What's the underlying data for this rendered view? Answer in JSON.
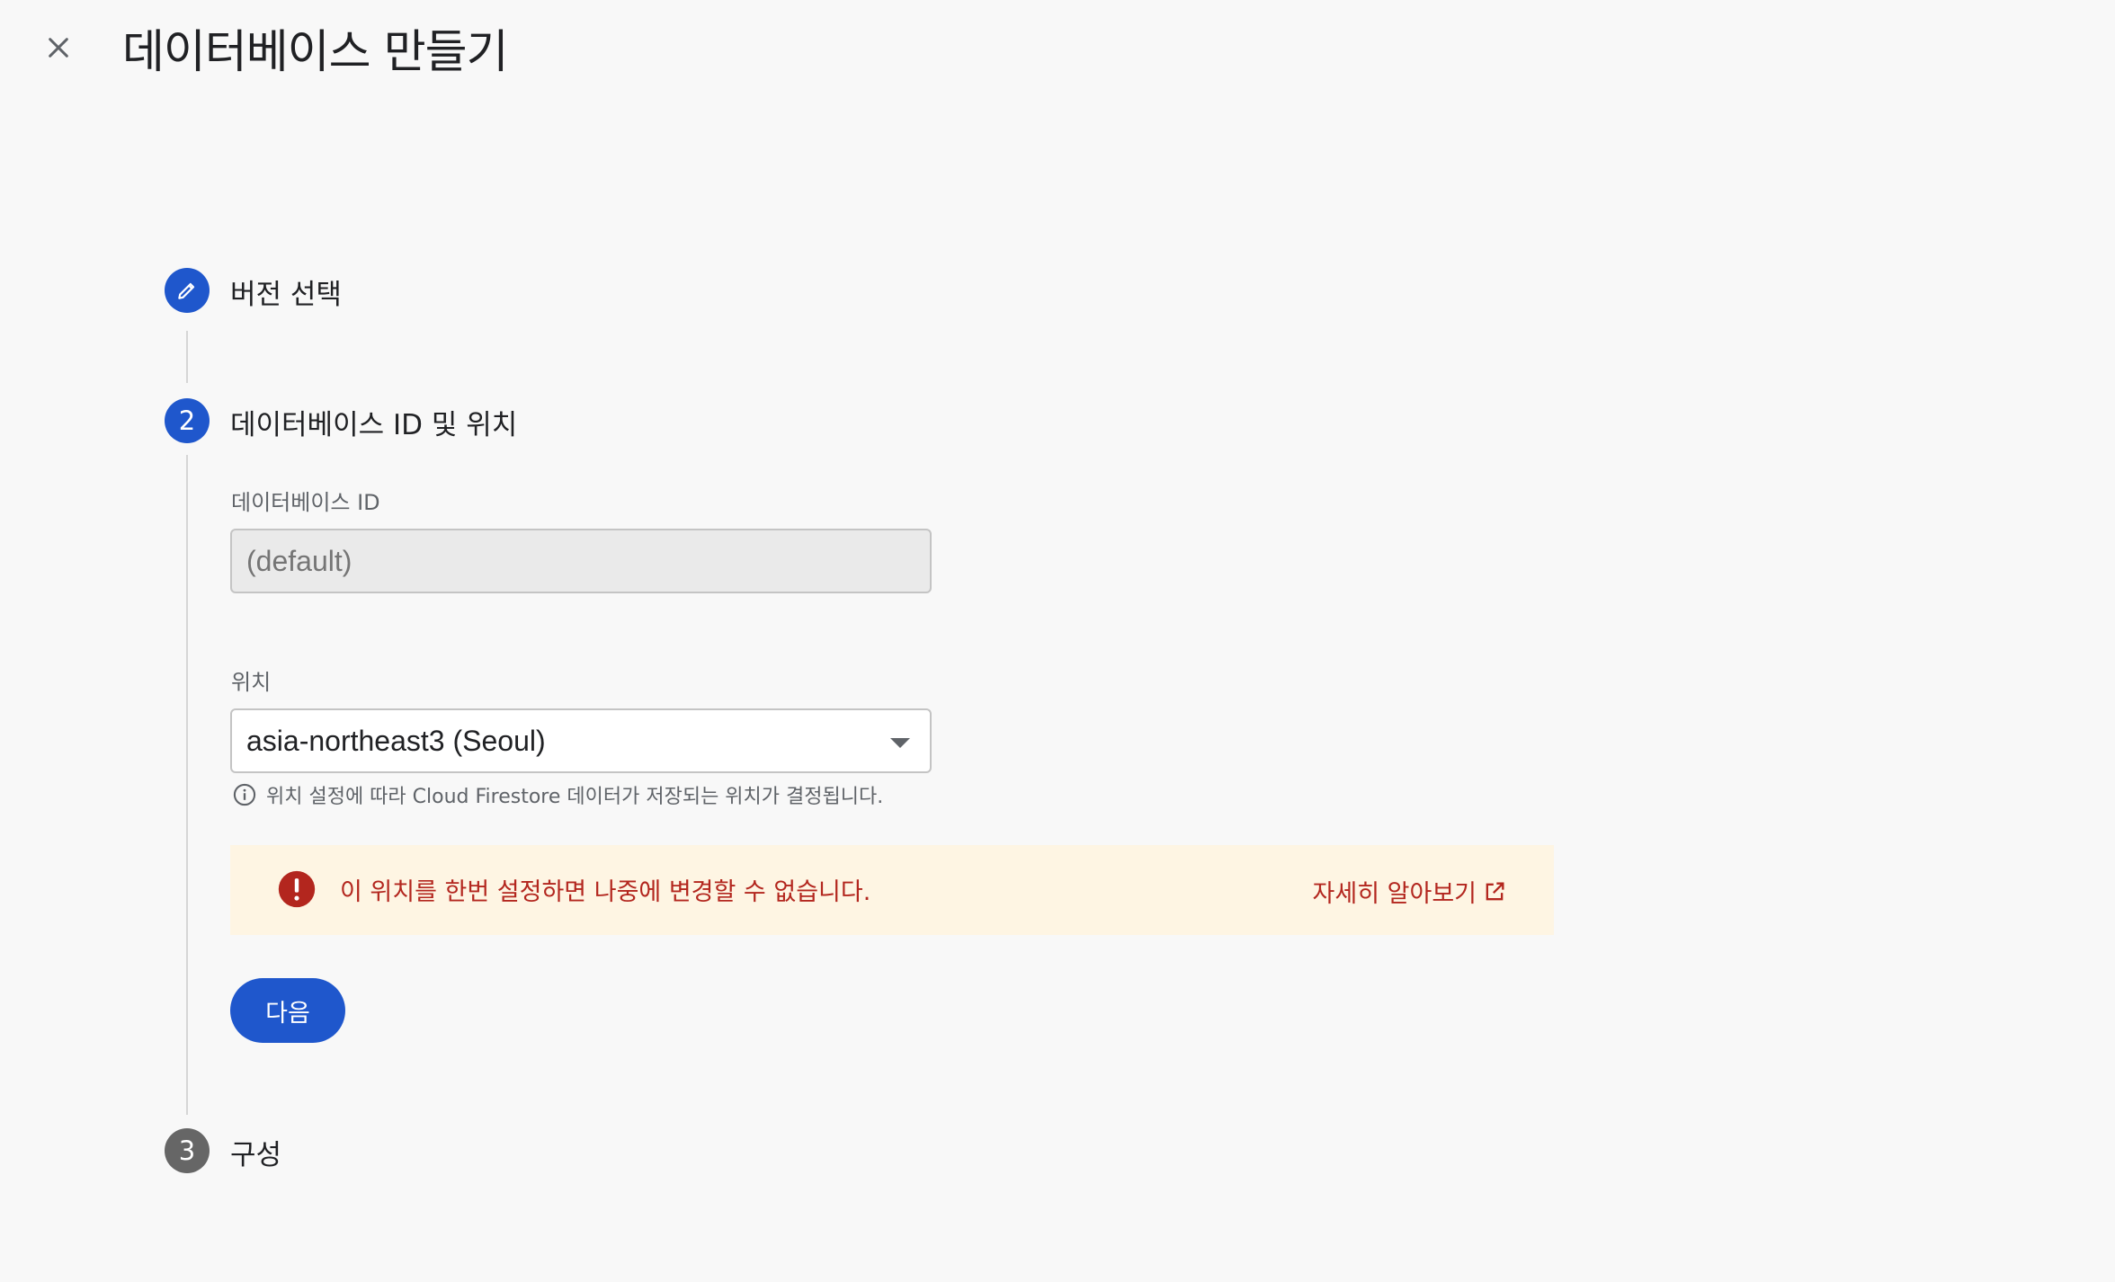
{
  "header": {
    "title": "데이터베이스 만들기",
    "close_icon": "close-icon"
  },
  "steps": [
    {
      "number": "",
      "label": "버전 선택",
      "state": "completed-edit",
      "icon": "pencil-icon"
    },
    {
      "number": "2",
      "label": "데이터베이스 ID 및 위치",
      "state": "active"
    },
    {
      "number": "3",
      "label": "구성",
      "state": "pending"
    }
  ],
  "form": {
    "database_id": {
      "label": "데이터베이스 ID",
      "placeholder": "(default)",
      "disabled": true
    },
    "location": {
      "label": "위치",
      "value": "asia-northeast3 (Seoul)",
      "hint": "위치 설정에 따라 Cloud Firestore 데이터가 저장되는 위치가 결정됩니다.",
      "hint_icon": "info-icon"
    }
  },
  "warning": {
    "icon": "error-icon",
    "text": "이 위치를 한번 설정하면 나중에 변경할 수 없습니다.",
    "link_label": "자세히 알아보기",
    "link_icon": "external-link-icon"
  },
  "actions": {
    "next_label": "다음"
  },
  "colors": {
    "primary": "#1f57cc",
    "pending_step": "#666666",
    "warning_bg": "#fef5e3",
    "warning_text": "#b3261e",
    "background": "#f8f8f8"
  }
}
